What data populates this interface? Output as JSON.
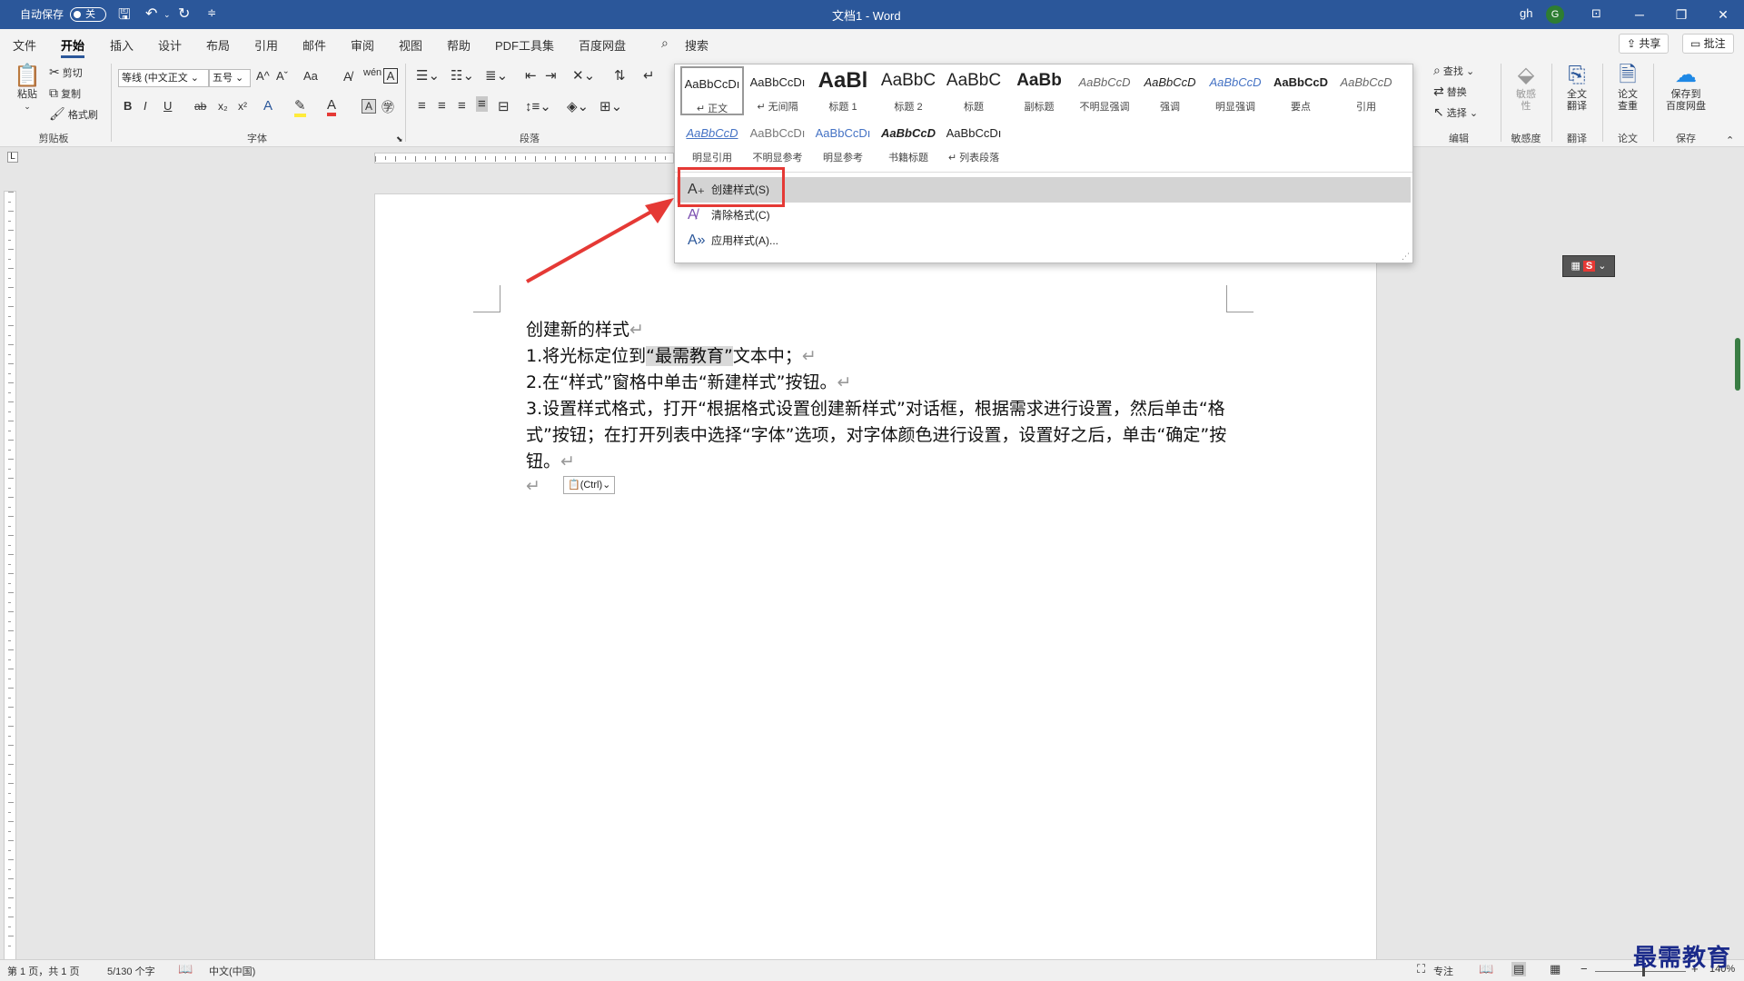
{
  "titlebar": {
    "autosave_label": "自动保存",
    "autosave_state": "关",
    "doc_title": "文档1 - Word",
    "user": "gh",
    "avatar": "G",
    "minimize": "─",
    "restore": "❐",
    "close": "✕"
  },
  "tabs": [
    "文件",
    "开始",
    "插入",
    "设计",
    "布局",
    "引用",
    "邮件",
    "审阅",
    "视图",
    "帮助",
    "PDF工具集",
    "百度网盘"
  ],
  "search_label": "搜索",
  "share_label": "共享",
  "comments_label": "批注",
  "ribbon": {
    "clipboard": {
      "paste": "粘贴",
      "cut": "剪切",
      "copy": "复制",
      "format_painter": "格式刷",
      "label": "剪贴板"
    },
    "font": {
      "font_name": "等线 (中文正文",
      "font_size": "五号",
      "label": "字体",
      "bold": "B",
      "italic": "I",
      "underline": "U",
      "strike": "ab",
      "sub": "x₂",
      "sup": "x²",
      "grow": "A^",
      "shrink": "Aˇ",
      "case": "Aa"
    },
    "paragraph": {
      "label": "段落"
    },
    "editing": {
      "find": "查找",
      "replace": "替换",
      "select": "选择",
      "label": "编辑"
    },
    "sensitivity": {
      "button": "敏感\n性",
      "label": "敏感度"
    },
    "translate": {
      "button": "全文\n翻译",
      "label": "翻译"
    },
    "paper": {
      "button": "论文\n查重",
      "label": "论文"
    },
    "save": {
      "button": "保存到\n百度网盘",
      "label": "保存"
    }
  },
  "style_gallery": {
    "row1": [
      {
        "preview": "AaBbCcDı",
        "name": "↵ 正文"
      },
      {
        "preview": "AaBbCcDı",
        "name": "↵ 无间隔"
      },
      {
        "preview": "AaBl",
        "name": "标题 1"
      },
      {
        "preview": "AaBbC",
        "name": "标题 2"
      },
      {
        "preview": "AaBbC",
        "name": "标题"
      },
      {
        "preview": "AaBb",
        "name": "副标题"
      },
      {
        "preview": "AaBbCcD",
        "name": "不明显强调"
      },
      {
        "preview": "AaBbCcD",
        "name": "强调"
      },
      {
        "preview": "AaBbCcD",
        "name": "明显强调"
      },
      {
        "preview": "AaBbCcD",
        "name": "要点"
      },
      {
        "preview": "AaBbCcD",
        "name": "引用"
      }
    ],
    "row2": [
      {
        "preview": "AaBbCcD",
        "name": "明显引用"
      },
      {
        "preview": "AaBbCcDı",
        "name": "不明显参考"
      },
      {
        "preview": "AaBbCcDı",
        "name": "明显参考"
      },
      {
        "preview": "AaBbCcD",
        "name": "书籍标题"
      },
      {
        "preview": "AaBbCcDı",
        "name": "↵ 列表段落"
      }
    ],
    "menu": [
      {
        "icon": "A₊",
        "label": "创建样式(S)"
      },
      {
        "icon": "A̸",
        "label": "清除格式(C)"
      },
      {
        "icon": "A»",
        "label": "应用样式(A)..."
      }
    ]
  },
  "document": {
    "lines": [
      "创建新的样式",
      "1.将光标定位到",
      "“最需教育”",
      "文本中；",
      "2.在“样式”窗格中单击“新建样式”按钮。",
      "3.设置样式格式，打开“根据格式设置创建新样式”对话框，根据需求进行设置，然后单击“格",
      "式”按钮；在打开列表中选择“字体”选项，对字体颜色进行设置，设置好之后，单击“确定”按",
      "钮。"
    ],
    "para_mark": "↵",
    "paste_options": "(Ctrl)"
  },
  "status": {
    "page": "第 1 页，共 1 页",
    "words": "5/130 个字",
    "lang": "中文(中国)",
    "focus": "专注",
    "zoom": "140%"
  },
  "watermark": "最需教育",
  "colors": {
    "accent": "#2b579a",
    "annotation": "#e53935"
  }
}
